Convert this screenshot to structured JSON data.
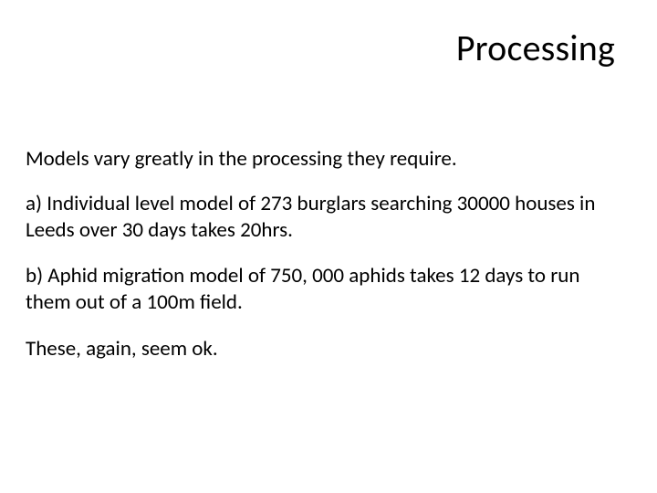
{
  "title": "Processing",
  "paragraphs": {
    "p0": "Models vary greatly in the processing they require.",
    "p1": "a) Individual level model of 273 burglars searching 30000 houses in Leeds over 30 days takes 20hrs.",
    "p2": " b) Aphid migration model of 750, 000 aphids takes 12 days to run them out of a 100m field.",
    "p3": "These, again, seem ok."
  }
}
